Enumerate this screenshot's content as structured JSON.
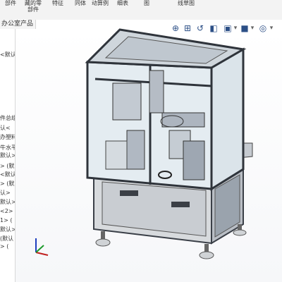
{
  "ribbon": {
    "items": [
      {
        "lines": [
          "部件"
        ]
      },
      {
        "lines": [
          "藏的零",
          "部件"
        ]
      },
      {
        "lines": [
          "特征"
        ]
      },
      {
        "lines": [
          "同体"
        ]
      },
      {
        "lines": [
          "动算例"
        ]
      },
      {
        "lines": [
          "细表"
        ]
      },
      {
        "lines": [
          "图"
        ]
      },
      {
        "lines": [
          "线草图"
        ]
      }
    ]
  },
  "tab": {
    "label": "办公室产品"
  },
  "tree": {
    "rows": [
      "<默认",
      "件总组",
      "认<",
      "办塑料",
      "牛水平",
      "默认>",
      "> (默",
      "<默认",
      "> (默",
      "认>",
      "默认>",
      "<2> (",
      "1> (",
      "默认>",
      "(默认",
      "> ("
    ]
  },
  "hud_icons": [
    "zoom-to-fit-icon",
    "zoom-area-icon",
    "previous-view-icon",
    "section-view-icon",
    "view-orientation-icon",
    "display-style-icon",
    "hide-show-icon"
  ],
  "colors": {
    "frame": "#3e4451",
    "panel": "#bfc6d0",
    "glass": "#dfe8ee",
    "base": "#d6d9dd"
  }
}
